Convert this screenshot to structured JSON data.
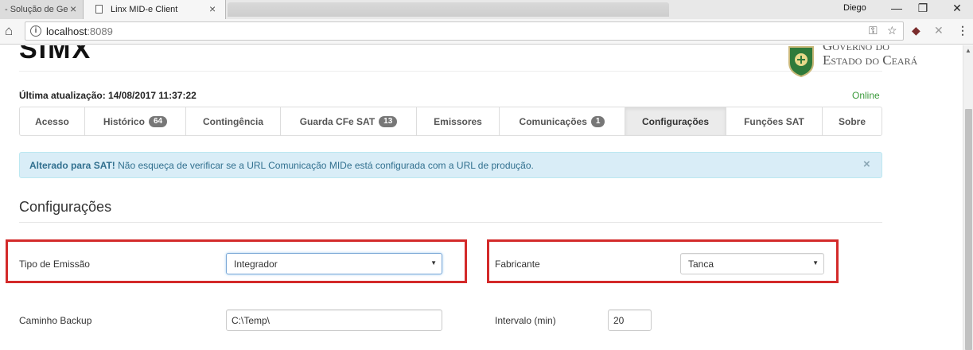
{
  "browser": {
    "tabs": [
      {
        "title": "- Solução de Ge",
        "close": "×"
      },
      {
        "title": "Linx MID-e Client",
        "close": "×"
      }
    ],
    "user_name": "Diego",
    "window_buttons": {
      "minimize": "—",
      "restore": "❐",
      "close": "✕"
    },
    "url_host": "localhost",
    "url_port": ":8089",
    "icons": {
      "home": "⌂",
      "info": "i",
      "key": "⚿",
      "star": "☆",
      "ext1": "◆",
      "ext2": "✕",
      "menu": "⋮"
    }
  },
  "header": {
    "logo_fragment": "SIMX",
    "gov_line1": "Governo do",
    "gov_line2": "Estado do Ceará",
    "last_update_label": "Última atualização: 14/08/2017 11:37:22",
    "status": "Online"
  },
  "nav_tabs": [
    {
      "label": "Acesso",
      "badge": ""
    },
    {
      "label": "Histórico",
      "badge": "64"
    },
    {
      "label": "Contingência",
      "badge": ""
    },
    {
      "label": "Guarda CFe SAT",
      "badge": "13"
    },
    {
      "label": "Emissores",
      "badge": ""
    },
    {
      "label": "Comunicações",
      "badge": "1"
    },
    {
      "label": "Configurações",
      "badge": "",
      "active": true
    },
    {
      "label": "Funções SAT",
      "badge": ""
    },
    {
      "label": "Sobre",
      "badge": ""
    }
  ],
  "alert": {
    "strong": "Alterado para SAT!",
    "text": " Não esqueça de verificar se a URL Comunicação MIDe está configurada com a URL de produção.",
    "close": "×"
  },
  "section_title": "Configurações",
  "fields": {
    "tipo_emissao": {
      "label": "Tipo de Emissão",
      "value": "Integrador"
    },
    "fabricante": {
      "label": "Fabricante",
      "value": "Tanca"
    },
    "caminho_backup": {
      "label": "Caminho Backup",
      "value": "C:\\Temp\\"
    },
    "intervalo": {
      "label": "Intervalo (min)",
      "value": "20"
    }
  },
  "colors": {
    "highlight_frame": "#d32a2a",
    "online": "#3c9b3c",
    "alert_bg": "#d9edf7",
    "alert_text": "#31708f",
    "badge": "#777777"
  }
}
